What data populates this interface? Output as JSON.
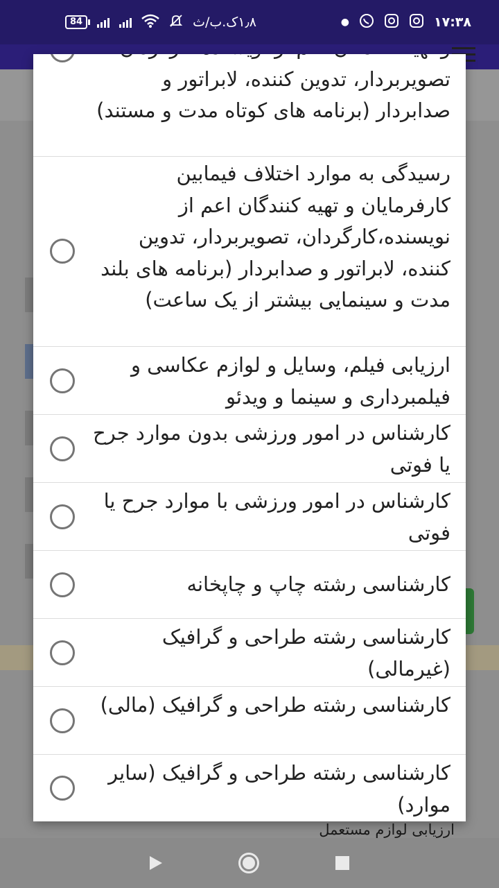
{
  "status_bar": {
    "time": "۱۷:۳۸",
    "speed": "۱٫۸ک.ب/ث",
    "battery": "84"
  },
  "background": {
    "bottom_text": "ارزیابی لوازم مستعمل"
  },
  "dialog": {
    "options": [
      {
        "label": "و تهیه کنندگان اعم از نویسنده،کارگردان، تصویربردار، تدوین کننده، لابراتور و صدابردار (برنامه های کوتاه مدت و مستند)",
        "selected": false
      },
      {
        "label": "رسیدگی به موارد اختلاف فیمابین کارفرمایان و تهیه کنندگان اعم از نویسنده،کارگردان، تصویربردار، تدوین کننده، لابراتور و صدابردار (برنامه های بلند مدت و سینمایی بیشتر از یک ساعت)",
        "selected": false
      },
      {
        "label": "ارزیابی فیلم، وسایل و لوازم عکاسی و فیلمبرداری و سینما و ویدئو",
        "selected": false
      },
      {
        "label": "کارشناس در امور ورزشی بدون موارد جرح یا فوتی",
        "selected": false
      },
      {
        "label": "کارشناس در امور ورزشی با موارد جرح یا فوتی",
        "selected": false
      },
      {
        "label": "کارشناسی رشته چاپ و چاپخانه",
        "selected": false
      },
      {
        "label": "کارشناسی رشته طراحی و گرافیک (غیرمالی)",
        "selected": false
      },
      {
        "label": "کارشناسی رشته طراحی و گرافیک (مالی)",
        "selected": false
      },
      {
        "label": "کارشناسی رشته طراحی و گرافیک (سایر موارد)",
        "selected": false
      }
    ]
  }
}
